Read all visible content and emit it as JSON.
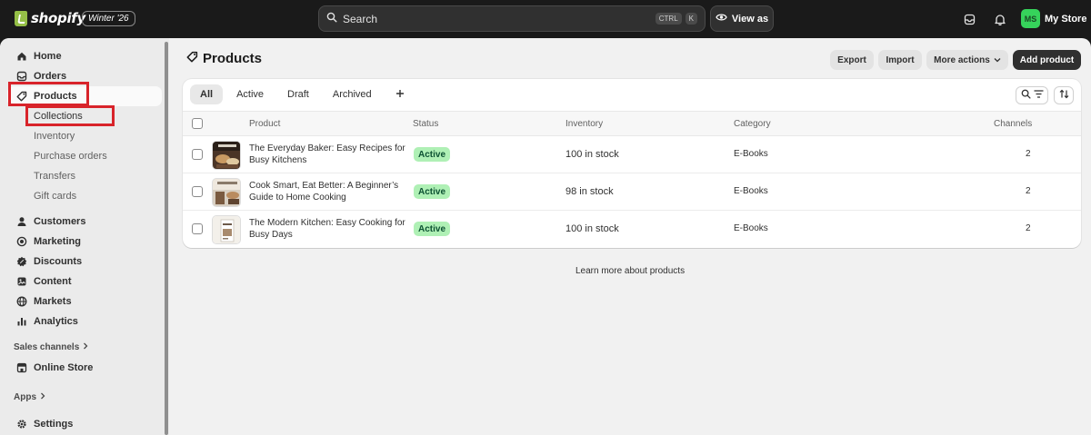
{
  "topbar": {
    "logo_text": "shopify",
    "edition_badge": "Winter '26",
    "search_label": "Search",
    "shortcut_keys": [
      "CTRL",
      "K"
    ],
    "view_as_label": "View as",
    "avatar_initials": "MS",
    "store_name": "My Store"
  },
  "sidebar": {
    "items": [
      {
        "label": "Home",
        "icon": "home-icon"
      },
      {
        "label": "Orders",
        "icon": "orders-icon"
      },
      {
        "label": "Products",
        "icon": "tag-icon",
        "active": true
      }
    ],
    "product_subitems": [
      "Collections",
      "Inventory",
      "Purchase orders",
      "Transfers",
      "Gift cards"
    ],
    "more_items": [
      {
        "label": "Customers",
        "icon": "person-icon"
      },
      {
        "label": "Marketing",
        "icon": "target-icon"
      },
      {
        "label": "Discounts",
        "icon": "discount-icon"
      },
      {
        "label": "Content",
        "icon": "content-icon"
      },
      {
        "label": "Markets",
        "icon": "globe-icon"
      },
      {
        "label": "Analytics",
        "icon": "chart-icon"
      }
    ],
    "sales_channels_label": "Sales channels",
    "online_store_label": "Online Store",
    "apps_label": "Apps",
    "settings_label": "Settings",
    "highlight_color": "#d8232a"
  },
  "page": {
    "title": "Products",
    "buttons": {
      "export": "Export",
      "import": "Import",
      "more_actions": "More actions",
      "add_product": "Add product"
    },
    "tabs": [
      "All",
      "Active",
      "Draft",
      "Archived"
    ],
    "active_tab": "All",
    "columns": [
      "Product",
      "Status",
      "Inventory",
      "Category",
      "Channels"
    ],
    "rows": [
      {
        "name": "The Everyday Baker: Easy Recipes for Busy Kitchens",
        "status": "Active",
        "inventory": "100 in stock",
        "category": "E-Books",
        "channels": "2"
      },
      {
        "name": "Cook Smart, Eat Better: A Beginner’s Guide to Home Cooking",
        "status": "Active",
        "inventory": "98 in stock",
        "category": "E-Books",
        "channels": "2"
      },
      {
        "name": "The Modern Kitchen: Easy Cooking for Busy Days",
        "status": "Active",
        "inventory": "100 in stock",
        "category": "E-Books",
        "channels": "2"
      }
    ],
    "footer_link": "Learn more about products",
    "status_color": "#aff0b5"
  }
}
